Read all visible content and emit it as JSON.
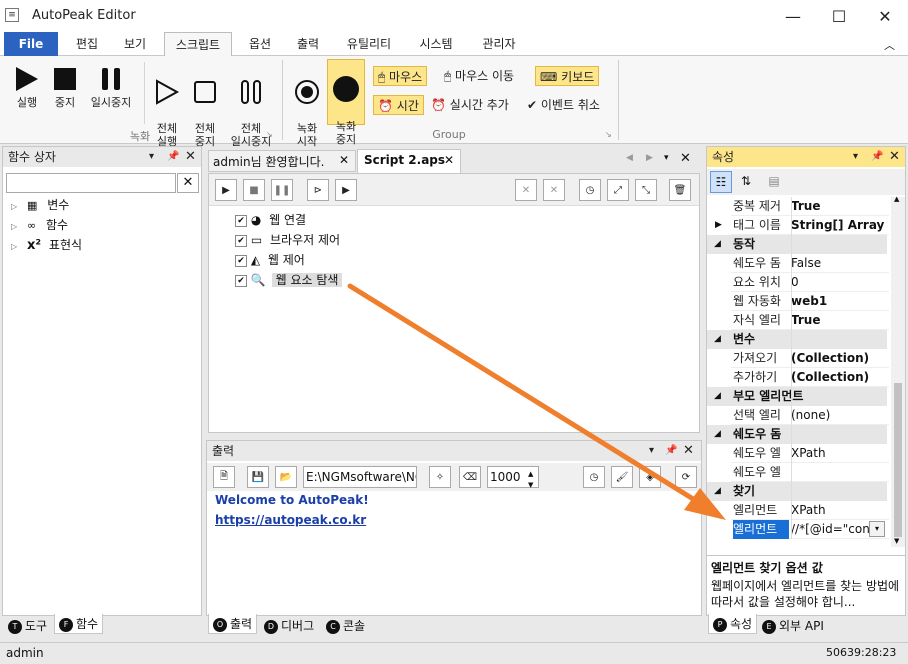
{
  "window": {
    "title": "AutoPeak Editor",
    "minimize": "—",
    "maximize": "☐",
    "close": "✕"
  },
  "menu_tabs": [
    "File",
    "편집",
    "보기",
    "스크립트",
    "옵션",
    "출력",
    "유틸리티",
    "시스템",
    "관리자"
  ],
  "ribbon": {
    "run": "실행",
    "stop": "중지",
    "pause": "일시중지",
    "run_all": "전체\n실행",
    "stop_all": "전체\n중지",
    "pause_all": "전체\n일시중지",
    "group_record": "녹화",
    "record_start": "녹화\n시작",
    "record_stop": "녹화\n중지",
    "mouse": "마우스",
    "mouse_move": "마우스 이동",
    "keyboard": "키보드",
    "time": "시간",
    "realtime_add": "실시간 추가",
    "event_cancel": "이벤트 취소",
    "group_group": "Group"
  },
  "left_panel": {
    "title": "함수 상자",
    "search_value": "",
    "tree": [
      {
        "label": "변수",
        "icon": "variable-icon"
      },
      {
        "label": "함수",
        "icon": "function-icon"
      },
      {
        "label": "표현식",
        "icon": "expression-icon"
      }
    ],
    "bottom_tabs": [
      {
        "badge": "T",
        "label": "도구"
      },
      {
        "badge": "F",
        "label": "함수"
      }
    ]
  },
  "doc_tabs": [
    {
      "label": "admin님 환영합니다."
    },
    {
      "label": "Script 2.aps"
    }
  ],
  "script_items": [
    {
      "label": "웹 연결",
      "checked": true
    },
    {
      "label": "브라우저 제어",
      "checked": true
    },
    {
      "label": "웹 제어",
      "checked": true
    },
    {
      "label": "웹 요소 탐색",
      "checked": true
    }
  ],
  "output": {
    "title": "출력",
    "path_value": "E:\\NGMsoftware\\NG",
    "count_value": "1000",
    "lines": [
      "Welcome to AutoPeak!",
      "https://autopeak.co.kr"
    ],
    "bottom_tabs": [
      {
        "badge": "O",
        "label": "출력"
      },
      {
        "badge": "D",
        "label": "디버그"
      },
      {
        "badge": "C",
        "label": "콘솔"
      }
    ]
  },
  "properties": {
    "title": "속성",
    "rows": [
      {
        "type": "row",
        "key": "중복 제거",
        "value": "True",
        "bold": true
      },
      {
        "type": "row",
        "key": "태그 이름",
        "value": "String[] Array",
        "bold": true,
        "expandable": true
      },
      {
        "type": "cat",
        "label": "동작"
      },
      {
        "type": "row",
        "key": "쉐도우 돔",
        "value": "False"
      },
      {
        "type": "row",
        "key": "요소 위치",
        "value": "0"
      },
      {
        "type": "row",
        "key": "웹 자동화",
        "value": "web1",
        "bold": true
      },
      {
        "type": "row",
        "key": "자식 엘리",
        "value": "True",
        "bold": true
      },
      {
        "type": "cat",
        "label": "변수"
      },
      {
        "type": "row",
        "key": "가져오기",
        "value": "(Collection)",
        "bold": true
      },
      {
        "type": "row",
        "key": "추가하기",
        "value": "(Collection)",
        "bold": true
      },
      {
        "type": "cat",
        "label": "부모 엘리먼트"
      },
      {
        "type": "row",
        "key": "선택 엘리",
        "value": "(none)"
      },
      {
        "type": "cat",
        "label": "쉐도우 돔"
      },
      {
        "type": "row",
        "key": "쉐도우 엘",
        "value": "XPath"
      },
      {
        "type": "row",
        "key": "쉐도우 엘",
        "value": ""
      },
      {
        "type": "cat",
        "label": "찾기"
      },
      {
        "type": "row",
        "key": "엘리먼트",
        "value": "XPath"
      },
      {
        "type": "row",
        "key": "엘리먼트",
        "value": "//*[@id=\"con",
        "selected": true
      }
    ],
    "desc_title": "엘리먼트 찾기 옵션 값",
    "desc_text": "웹페이지에서 엘리먼트를 찾는 방법에 따라서 값을 설정해야 합니...",
    "bottom_tabs": [
      {
        "badge": "P",
        "label": "속성"
      },
      {
        "badge": "E",
        "label": "외부 API"
      }
    ]
  },
  "status": {
    "user": "admin",
    "time": "50639:28:23"
  },
  "colors": {
    "accent": "#2c63c0",
    "highlight": "#fde58a",
    "selection": "#1a6fd6",
    "arrow": "#f07f2d",
    "link": "#1a3fa8"
  }
}
